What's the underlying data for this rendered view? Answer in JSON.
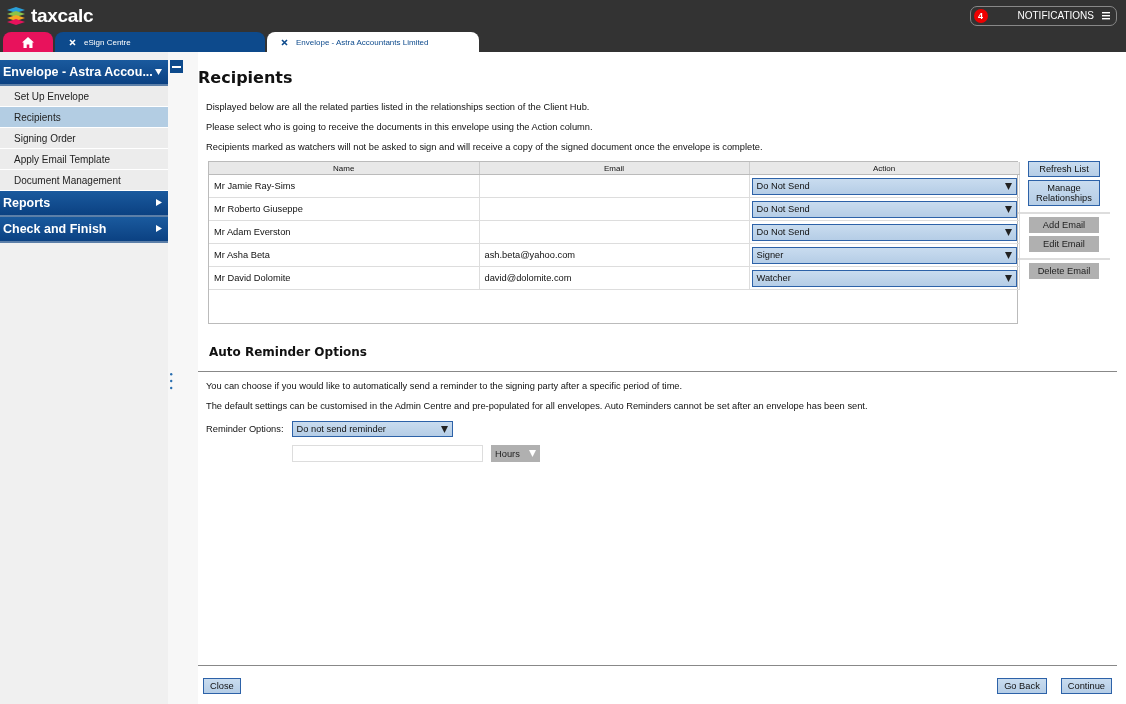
{
  "header": {
    "logo": "taxcalc",
    "notifications": {
      "count": "4",
      "label": "NOTIFICATIONS"
    }
  },
  "tabs": [
    {
      "kind": "home",
      "selected": false
    },
    {
      "kind": "page",
      "label": "eSign Centre",
      "selected": false
    },
    {
      "kind": "page",
      "label": "Envelope - Astra Accountants Limited",
      "selected": true
    }
  ],
  "sidebar": {
    "sections": [
      {
        "title": "Envelope - Astra Accou...",
        "expanded": true,
        "items": [
          {
            "label": "Set Up Envelope",
            "selected": false
          },
          {
            "label": "Recipients",
            "selected": true
          },
          {
            "label": "Signing Order",
            "selected": false
          },
          {
            "label": "Apply Email Template",
            "selected": false
          },
          {
            "label": "Document Management",
            "selected": false
          }
        ]
      },
      {
        "title": "Reports",
        "expanded": false
      },
      {
        "title": "Check and Finish",
        "expanded": false
      }
    ]
  },
  "page": {
    "title": "Recipients",
    "intro": [
      "Displayed below are all the related parties listed in the relationships section of the Client Hub.",
      "Please select who is going to receive the documents in this envelope using the Action column.",
      "Recipients marked as watchers will not be asked to sign and will receive a copy of the signed document once the envelope is complete."
    ],
    "table": {
      "columns": [
        "Name",
        "Email",
        "Action"
      ],
      "rows": [
        {
          "name": "Mr Jamie Ray-Sims",
          "email": "",
          "action": "Do Not Send"
        },
        {
          "name": "Mr Roberto Giuseppe",
          "email": "",
          "action": "Do Not Send"
        },
        {
          "name": "Mr Adam Everston",
          "email": "",
          "action": "Do Not Send"
        },
        {
          "name": "Mr Asha Beta",
          "email": "ash.beta@yahoo.com",
          "action": "Signer"
        },
        {
          "name": "Mr David Dolomite",
          "email": "david@dolomite.com",
          "action": "Watcher"
        }
      ]
    },
    "side_button_groups": [
      [
        {
          "label": "Refresh List",
          "disabled": false
        },
        {
          "label": "Manage Relationships",
          "disabled": false
        }
      ],
      [
        {
          "label": "Add Email",
          "disabled": true
        },
        {
          "label": "Edit Email",
          "disabled": true
        }
      ],
      [
        {
          "label": "Delete Email",
          "disabled": true
        }
      ]
    ],
    "reminder": {
      "title": "Auto Reminder Options",
      "texts": [
        "You can choose if you would like to automatically send a reminder to the signing party after a specific period of time.",
        "The default settings can be customised in the Admin Centre and pre-populated for all envelopes. Auto Reminders cannot be set after an envelope has been sent."
      ],
      "label": "Reminder Options:",
      "option": "Do not send reminder",
      "unit": "Hours",
      "unit_disabled": true
    },
    "footer": {
      "left": [
        "Close"
      ],
      "right": [
        "Go Back",
        "Continue"
      ]
    }
  }
}
